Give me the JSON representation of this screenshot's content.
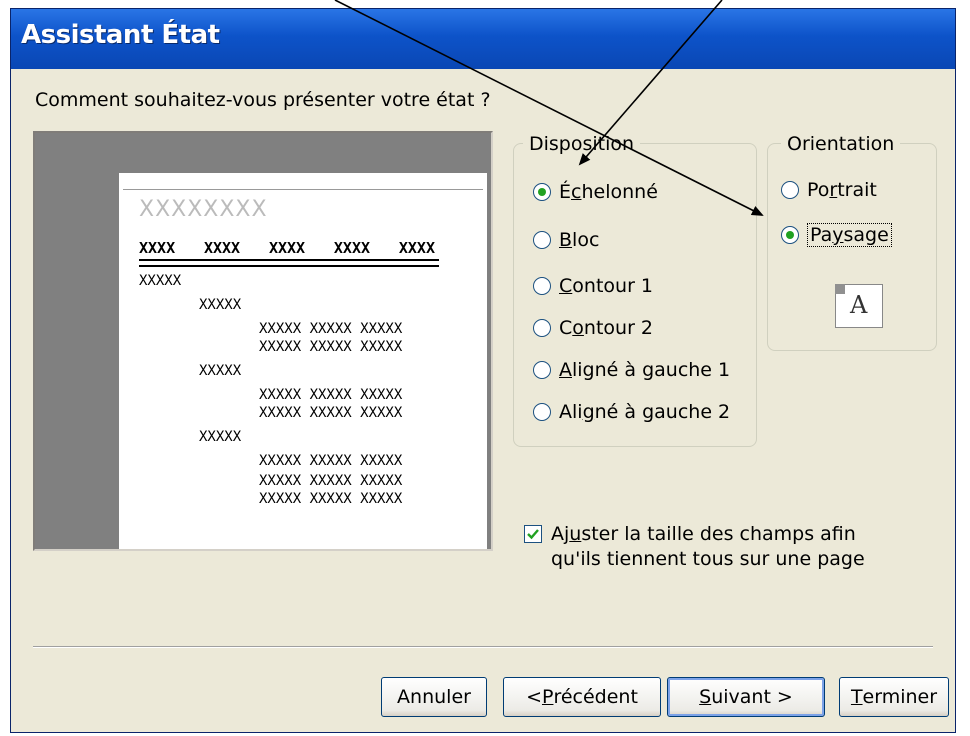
{
  "window": {
    "title": "Assistant État"
  },
  "question": "Comment souhaitez-vous présenter votre état ?",
  "preview": {
    "title_placeholder": "XXXXXXXX",
    "headers": [
      "XXXX",
      "XXXX",
      "XXXX",
      "XXXX",
      "XXXX"
    ],
    "level1": "XXXXX",
    "level2": "XXXXX",
    "detail": "XXXXX  XXXXX  XXXXX"
  },
  "disposition": {
    "legend": "Disposition",
    "options": [
      {
        "pre": "É",
        "key": "c",
        "post": "helonné",
        "selected": true
      },
      {
        "pre": "",
        "key": "B",
        "post": "loc",
        "selected": false
      },
      {
        "pre": "",
        "key": "C",
        "post": "ontour 1",
        "selected": false
      },
      {
        "pre": "C",
        "key": "o",
        "post": "ntour 2",
        "selected": false
      },
      {
        "pre": "",
        "key": "A",
        "post": "ligné à gauche 1",
        "selected": false
      },
      {
        "pre": "Ali",
        "key": "g",
        "post": "né à gauche 2",
        "selected": false
      }
    ]
  },
  "orientation": {
    "legend": "Orientation",
    "portrait": {
      "pre": "Po",
      "key": "r",
      "post": "trait",
      "selected": false
    },
    "paysage": {
      "pre": "Pa",
      "key": "y",
      "post": "sage",
      "selected": true
    },
    "icon_letter": "A"
  },
  "fit_checkbox": {
    "checked": true,
    "pre": "Aj",
    "key": "u",
    "post": "ster la taille des champs afin qu'ils tiennent tous sur une page"
  },
  "buttons": {
    "cancel": "Annuler",
    "back_pre": "< ",
    "back_key": "P",
    "back_post": "récédent",
    "next_key": "S",
    "next_post": "uivant >",
    "finish_key": "T",
    "finish_post": "erminer"
  },
  "colors": {
    "titlebar": "#0a47b4",
    "radio_dot": "#21a121",
    "face": "#ece9d8"
  }
}
